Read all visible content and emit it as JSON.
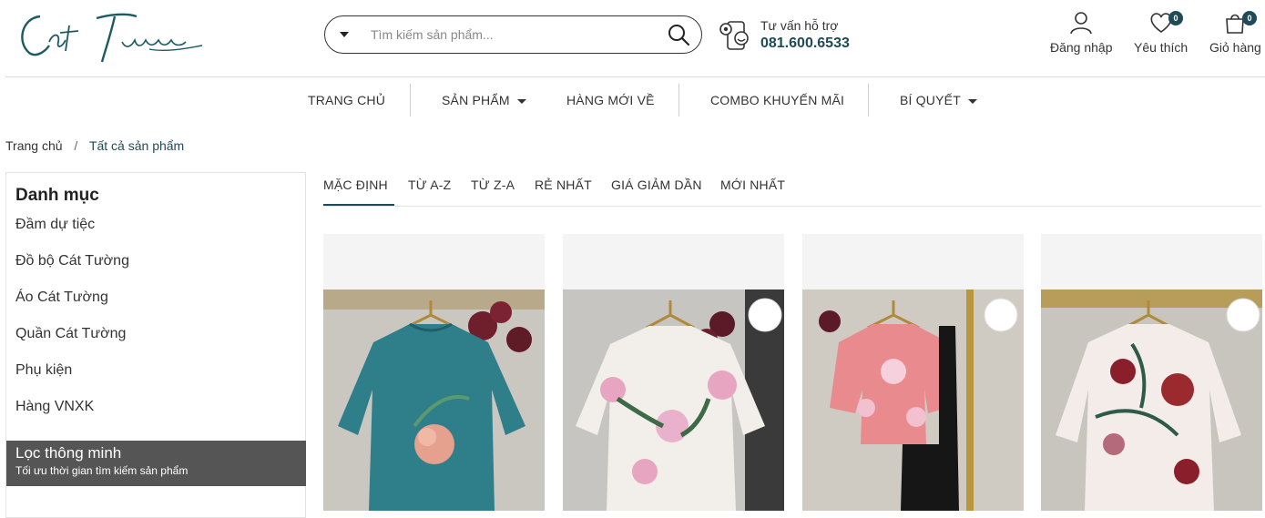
{
  "header": {
    "search_placeholder": "Tìm kiếm sản phẩm...",
    "support_label": "Tư vấn hỗ trợ",
    "support_phone": "081.600.6533",
    "login_label": "Đăng nhập",
    "wishlist_label": "Yêu thích",
    "wishlist_count": "0",
    "cart_label": "Giỏ hàng",
    "cart_count": "0"
  },
  "nav": {
    "items": [
      {
        "label": "TRANG CHỦ"
      },
      {
        "label": "SẢN PHẨM"
      },
      {
        "label": "HÀNG MỚI VỀ"
      },
      {
        "label": "COMBO KHUYẾN MÃI"
      },
      {
        "label": "BÍ QUYẾT"
      }
    ]
  },
  "breadcrumb": {
    "home": "Trang chủ",
    "separator": "/",
    "current": "Tất cả sản phẩm"
  },
  "sidebar": {
    "title": "Danh mục",
    "categories": [
      {
        "label": "Đầm dự tiệc"
      },
      {
        "label": "Đồ bộ Cát Tường"
      },
      {
        "label": "Áo Cát Tường"
      },
      {
        "label": "Quần Cát Tường"
      },
      {
        "label": "Phụ kiện"
      },
      {
        "label": "Hàng VNXK"
      }
    ],
    "smart_filter_title": "Lọc thông minh",
    "smart_filter_subtitle": "Tối ưu thời gian tìm kiếm sản phẩm"
  },
  "sort_tabs": [
    {
      "label": "MẶC ĐỊNH",
      "active": true
    },
    {
      "label": "TỪ A-Z"
    },
    {
      "label": "TỪ Z-A"
    },
    {
      "label": "RẺ NHẤT"
    },
    {
      "label": "GIÁ GIẢM DẦN"
    },
    {
      "label": "MỚI NHẤT"
    }
  ],
  "products": [
    {
      "color": "#2f7f8a"
    },
    {
      "color": "#f2efea"
    },
    {
      "color": "#e98a8e"
    },
    {
      "color": "#f3ece8"
    }
  ],
  "colors": {
    "accent": "#1e4b57",
    "filter_bg": "#555555"
  }
}
